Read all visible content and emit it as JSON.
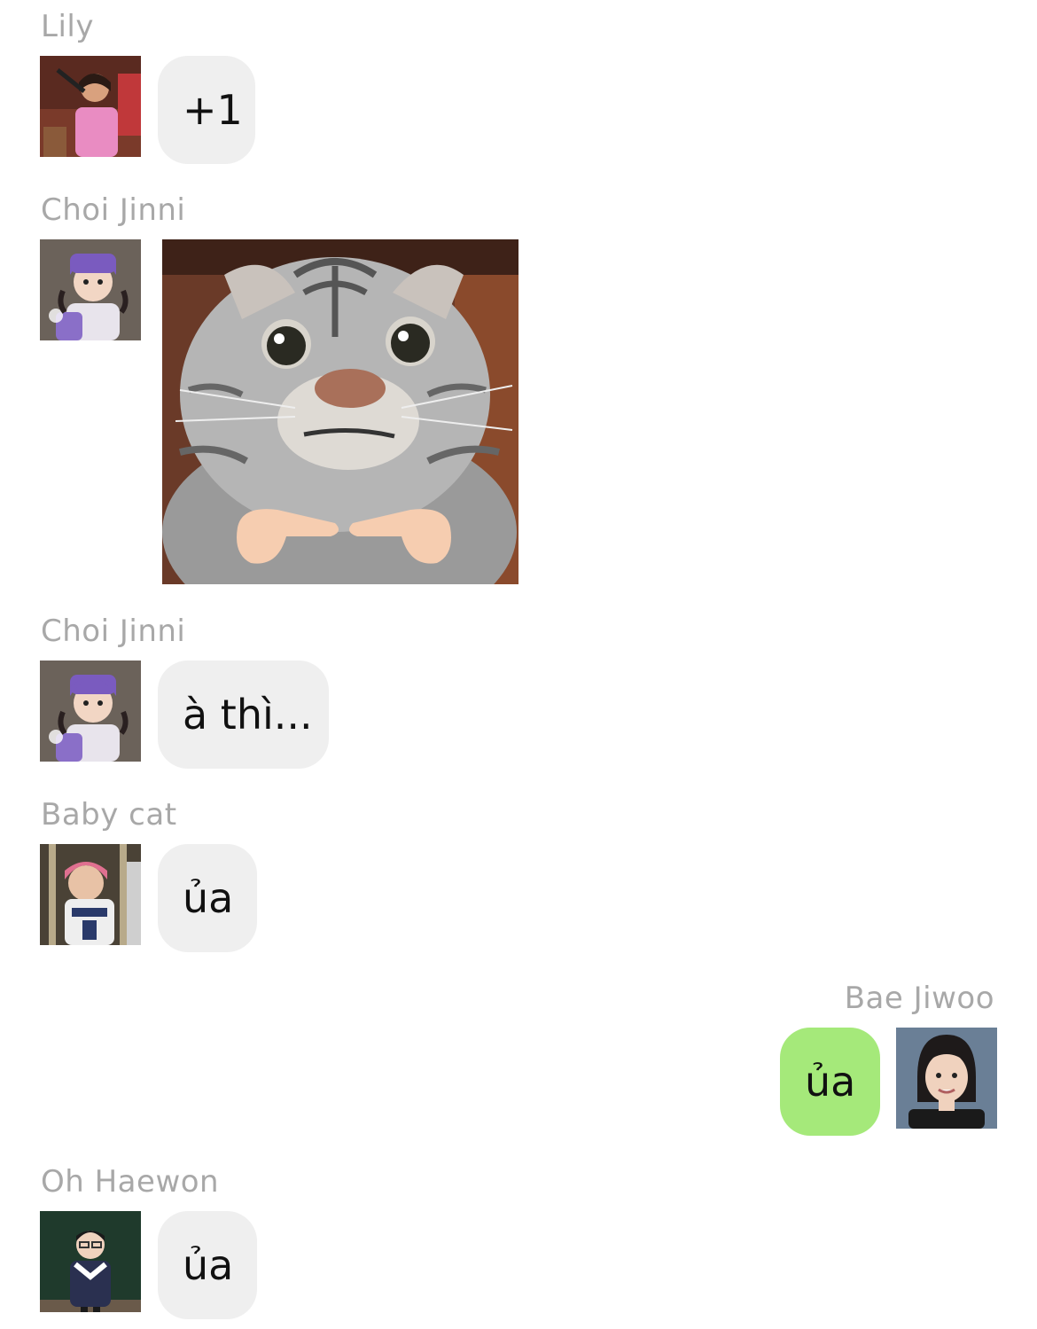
{
  "messages": [
    {
      "sender": "Lily",
      "type": "text",
      "text": "+1",
      "side": "left"
    },
    {
      "sender": "Choi Jinni",
      "type": "sticker",
      "sticker": "cat-pointing-fingers-sticker",
      "side": "left"
    },
    {
      "sender": "Choi Jinni",
      "type": "text",
      "text": "à thì...",
      "side": "left"
    },
    {
      "sender": "Baby cat",
      "type": "text",
      "text": "ủa",
      "side": "left"
    },
    {
      "sender": "Bae Jiwoo",
      "type": "text",
      "text": "ủa",
      "side": "right"
    },
    {
      "sender": "Oh Haewon",
      "type": "text",
      "text": "ủa",
      "side": "left"
    }
  ],
  "colors": {
    "incoming_bubble": "#efefef",
    "outgoing_bubble": "#a5e97a",
    "sender_name": "#a8a8a8"
  }
}
